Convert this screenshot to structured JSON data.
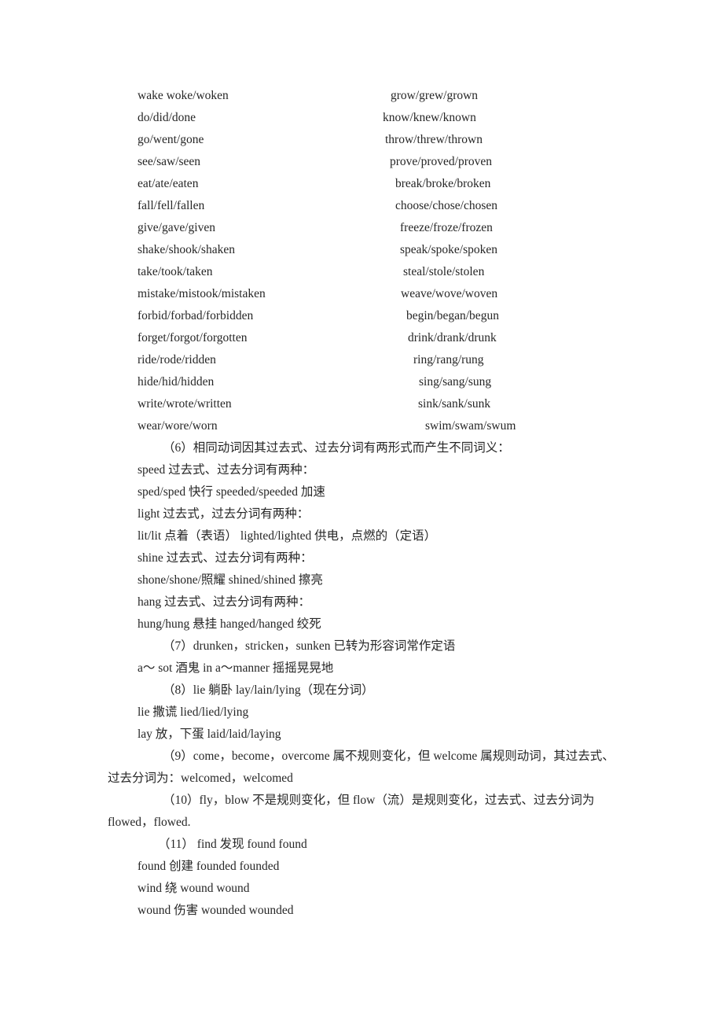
{
  "document": {
    "background_color": "#ffffff",
    "text_color": "#262626"
  },
  "verb_table": {
    "rows": [
      {
        "left": "wake woke/woken",
        "right": "grow/grew/grown",
        "right_indent": 60
      },
      {
        "left": "do/did/done",
        "right": "know/knew/known",
        "right_indent": 50
      },
      {
        "left": "go/went/gone",
        "right": "throw/threw/thrown",
        "right_indent": 53
      },
      {
        "left": "see/saw/seen",
        "right": "prove/proved/proven",
        "right_indent": 59
      },
      {
        "left": "eat/ate/eaten",
        "right": "break/broke/broken",
        "right_indent": 66
      },
      {
        "left": "fall/fell/fallen",
        "right": "choose/chose/chosen",
        "right_indent": 66
      },
      {
        "left": "give/gave/given",
        "right": "freeze/froze/frozen",
        "right_indent": 72
      },
      {
        "left": "shake/shook/shaken",
        "right": "speak/spoke/spoken",
        "right_indent": 72
      },
      {
        "left": "take/took/taken",
        "right": "steal/stole/stolen",
        "right_indent": 76
      },
      {
        "left": "mistake/mistook/mistaken",
        "right": "weave/wove/woven",
        "right_indent": 73
      },
      {
        "left": "forbid/forbad/forbidden",
        "right": "begin/began/begun",
        "right_indent": 80
      },
      {
        "left": "forget/forgot/forgotten",
        "right": "drink/drank/drunk",
        "right_indent": 82
      },
      {
        "left": "ride/rode/ridden",
        "right": "ring/rang/rung",
        "right_indent": 89
      },
      {
        "left": "hide/hid/hidden",
        "right": "sing/sang/sung",
        "right_indent": 96
      },
      {
        "left": "write/wrote/written",
        "right": "sink/sank/sunk",
        "right_indent": 95
      },
      {
        "left": "wear/wore/worn",
        "right": "swim/swam/swum",
        "right_indent": 104
      }
    ]
  },
  "notes": {
    "item6_heading": "（6）相同动词因其过去式、过去分词有两形式而产生不同词义：",
    "speed_heading": "speed 过去式、过去分词有两种：",
    "speed_forms": "sped/sped 快行  speeded/speeded 加速",
    "light_heading": "light 过去式，过去分词有两种：",
    "light_forms": "lit/lit 点着（表语） lighted/lighted 供电，点燃的（定语）",
    "shine_heading": "shine 过去式、过去分词有两种：",
    "shine_forms": "shone/shone/照耀  shined/shined 擦亮",
    "hang_heading": "hang 过去式、过去分词有两种：",
    "hang_forms": "hung/hung 悬挂  hanged/hanged 绞死",
    "item7": "（7）drunken，stricken，sunken 已转为形容词常作定语",
    "item7_example": "a～ sot 酒鬼  in a～manner 摇摇晃晃地",
    "item8": "（8）lie 躺卧 lay/lain/lying（现在分词）",
    "item8_lie": "lie 撒谎  lied/lied/lying",
    "item8_lay": "lay 放，下蛋 laid/laid/laying",
    "item9": "（9）come，become，overcome 属不规则变化，但 welcome 属规则动词，其过去式、过去分词为：welcomed，welcomed",
    "item10": "（10）fly，blow 不是规则变化，但 flow（流）是规则变化，过去式、过去分词为flowed，flowed.",
    "item11": "（11） find 发现  found found",
    "item11_found": "found 创建  founded founded",
    "item11_wind": "wind 绕  wound wound",
    "item11_wound": "wound 伤害  wounded wounded"
  }
}
